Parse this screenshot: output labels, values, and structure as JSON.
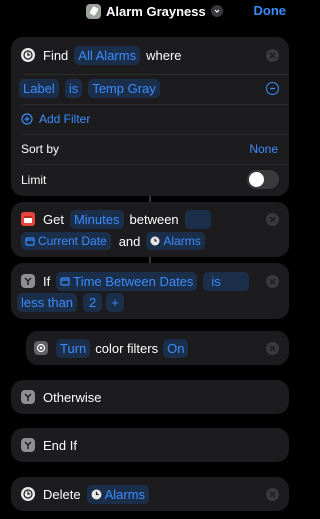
{
  "header": {
    "title": "Alarm Grayness",
    "done_label": "Done"
  },
  "find": {
    "verb": "Find",
    "target": "All Alarms",
    "where": "where",
    "filter": {
      "field": "Label",
      "operator": "is",
      "value": "Temp Gray"
    },
    "add_filter": "Add Filter",
    "sort_by_label": "Sort by",
    "sort_by_value": "None",
    "limit_label": "Limit"
  },
  "get": {
    "verb": "Get",
    "unit": "Minutes",
    "between": "between",
    "start": "Current Date",
    "and": "and",
    "end": "Alarms"
  },
  "if_block": {
    "verb": "If",
    "input": "Time Between Dates",
    "is": "is",
    "condition": "less than",
    "value": "2",
    "plus": "+"
  },
  "turn": {
    "verb": "Turn",
    "object": "color filters",
    "state": "On"
  },
  "otherwise": {
    "label": "Otherwise"
  },
  "end_if": {
    "label": "End If"
  },
  "delete": {
    "verb": "Delete",
    "target": "Alarms"
  },
  "colors": {
    "accent": "#3b8cff",
    "card": "#1c1c1e",
    "pill": "#1c2f4a",
    "background": "#000000"
  }
}
